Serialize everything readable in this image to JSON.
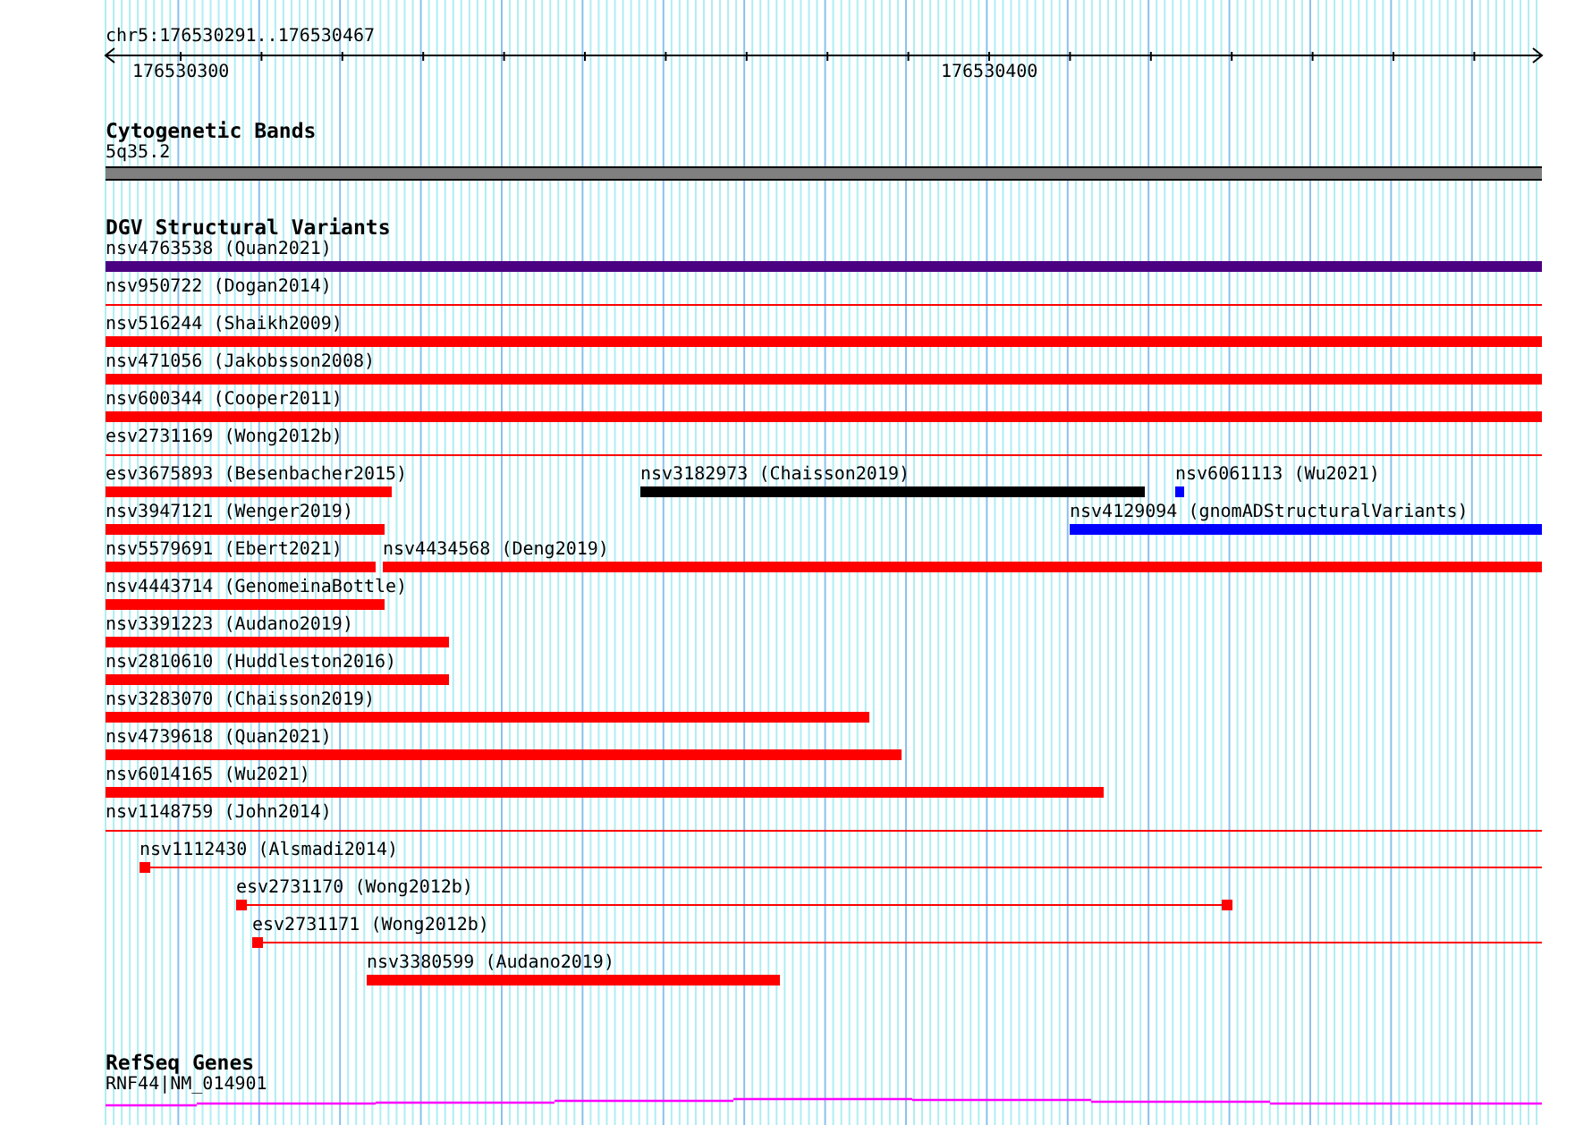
{
  "location": "chr5:176530291..176530467",
  "ruler": {
    "ticks": [
      {
        "label": "176530300"
      },
      {
        "label": "176530400"
      }
    ]
  },
  "tracks": [
    {
      "kind": "bands",
      "title": "Cytogenetic Bands",
      "features": [
        {
          "label": "5q35.2"
        }
      ]
    },
    {
      "kind": "variants",
      "title": "DGV Structural Variants",
      "features": [
        {
          "label": "nsv4763538 (Quan2021)",
          "color": "#4b0082",
          "kind": "bar"
        },
        {
          "label": "nsv950722 (Dogan2014)",
          "color": "#ff0000",
          "kind": "line"
        },
        {
          "label": "nsv516244 (Shaikh2009)",
          "color": "#ff0000",
          "kind": "bar"
        },
        {
          "label": "nsv471056 (Jakobsson2008)",
          "color": "#ff0000",
          "kind": "bar"
        },
        {
          "label": "nsv600344 (Cooper2011)",
          "color": "#ff0000",
          "kind": "bar"
        },
        {
          "label": "esv2731169 (Wong2012b)",
          "color": "#ff0000",
          "kind": "line"
        },
        {
          "label": "esv3675893 (Besenbacher2015)",
          "color": "#ff0000",
          "kind": "bar"
        },
        {
          "label": "nsv3182973 (Chaisson2019)",
          "color": "#000000",
          "kind": "bar"
        },
        {
          "label": "nsv6061113 (Wu2021)",
          "color": "#0000ff",
          "kind": "bar"
        },
        {
          "label": "nsv3947121 (Wenger2019)",
          "color": "#ff0000",
          "kind": "bar"
        },
        {
          "label": "nsv4129094 (gnomADStructuralVariants)",
          "color": "#0000ff",
          "kind": "bar"
        },
        {
          "label": "nsv5579691 (Ebert2021)",
          "color": "#ff0000",
          "kind": "bar"
        },
        {
          "label": "nsv4434568 (Deng2019)",
          "color": "#ff0000",
          "kind": "bar"
        },
        {
          "label": "nsv4443714 (GenomeinaBottle)",
          "color": "#ff0000",
          "kind": "bar"
        },
        {
          "label": "nsv3391223 (Audano2019)",
          "color": "#ff0000",
          "kind": "bar"
        },
        {
          "label": "nsv2810610 (Huddleston2016)",
          "color": "#ff0000",
          "kind": "bar"
        },
        {
          "label": "nsv3283070 (Chaisson2019)",
          "color": "#ff0000",
          "kind": "bar"
        },
        {
          "label": "nsv4739618 (Quan2021)",
          "color": "#ff0000",
          "kind": "bar"
        },
        {
          "label": "nsv6014165 (Wu2021)",
          "color": "#ff0000",
          "kind": "bar"
        },
        {
          "label": "nsv1148759 (John2014)",
          "color": "#ff0000",
          "kind": "line"
        },
        {
          "label": "nsv1112430 (Alsmadi2014)",
          "color": "#ff0000",
          "kind": "marked"
        },
        {
          "label": "esv2731170 (Wong2012b)",
          "color": "#ff0000",
          "kind": "marked"
        },
        {
          "label": "esv2731171 (Wong2012b)",
          "color": "#ff0000",
          "kind": "marked"
        },
        {
          "label": "nsv3380599 (Audano2019)",
          "color": "#ff0000",
          "kind": "bar"
        }
      ]
    },
    {
      "kind": "genes",
      "title": "RefSeq Genes",
      "features": [
        {
          "label": "RNF44|NM_014901"
        }
      ]
    }
  ]
}
